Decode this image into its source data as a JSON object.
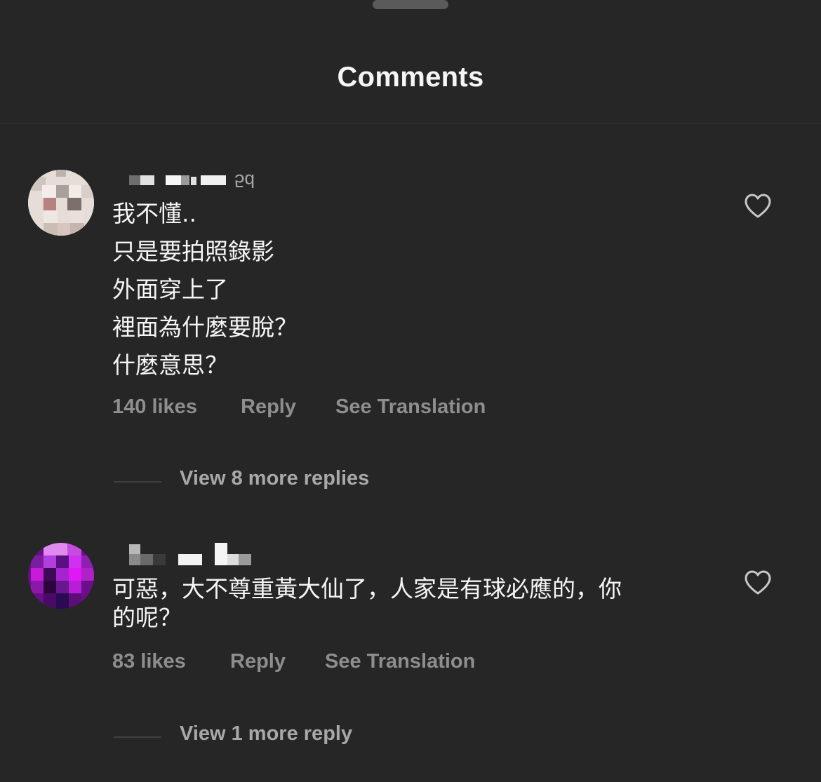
{
  "sheet": {
    "title": "Comments"
  },
  "comments": [
    {
      "age": "5d",
      "lines": [
        "我不懂..",
        "只是要拍照錄影",
        "外面穿上了",
        "裡面為什麼要脫？",
        "什麼意思？"
      ],
      "likes": "140 likes",
      "reply_label": "Reply",
      "translate_label": "See Translation",
      "view_replies": "View 8 more replies"
    },
    {
      "age": "",
      "lines": [
        "可惡，大不尊重黃大仙了，人家是有球必應的，你",
        "的呢？"
      ],
      "likes": "83 likes",
      "reply_label": "Reply",
      "translate_label": "See Translation",
      "view_replies": "View 1 more reply"
    }
  ],
  "colors": {
    "background": "#262626",
    "primary_text": "#f5f5f5",
    "secondary_text": "#8e8e8e",
    "link_text": "#a8a8a8"
  },
  "icons": {
    "like": "heart-outline-icon",
    "avatar": "blurred-profile-avatar"
  }
}
